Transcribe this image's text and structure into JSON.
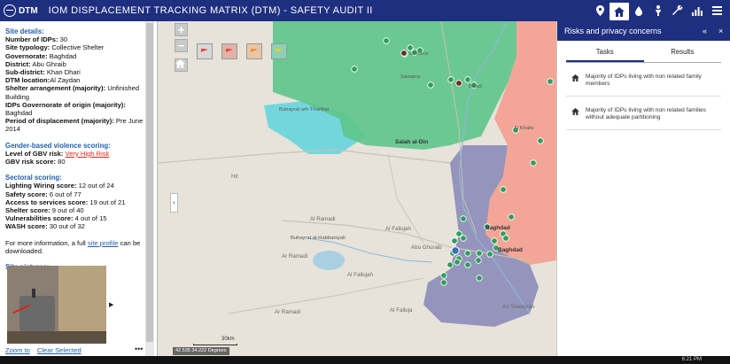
{
  "app": {
    "logo_text": "DTM",
    "title": "IOM  DISPLACEMENT TRACKING MATRIX (DTM) - SAFETY AUDIT II"
  },
  "header_icons": [
    "location-pin-icon",
    "home-icon",
    "water-drop-icon",
    "person-icon",
    "wrench-icon",
    "bar-chart-icon",
    "menu-icon"
  ],
  "site_details": {
    "heading": "Site details:",
    "rows": [
      {
        "label": "Number of IDPs:",
        "value": " 30"
      },
      {
        "label": "Site typology:",
        "value": " Collective Shelter"
      },
      {
        "label": "Governorate:",
        "value": " Baghdad"
      },
      {
        "label": "District:",
        "value": " Abu Ghraib"
      },
      {
        "label": "Sub-district:",
        "value": " Khan Dhari"
      },
      {
        "label": "DTM location:",
        "value": "Al Zaydan"
      },
      {
        "label": "Shelter arrangement (majority):",
        "value": " Unfinished Building"
      },
      {
        "label": "IDPs Governorate of origin (majority):",
        "value": " Baghdad"
      },
      {
        "label": "Period of displacement (majority):",
        "value": " Pre June 2014"
      }
    ]
  },
  "gbv": {
    "heading": "Gender-based violence scoring:",
    "risk_label": "Level of GBV risk:",
    "risk_value": "Very High Risk",
    "score_label": "GBV risk score:",
    "score_value": " 80"
  },
  "sectoral": {
    "heading": "Sectoral scoring:",
    "rows": [
      {
        "label": "Lighting Wiring score:",
        "value": " 12 out of 24"
      },
      {
        "label": "Safety score:",
        "value": " 6 out of 77"
      },
      {
        "label": "Access to services score:",
        "value": " 19 out of 21"
      },
      {
        "label": "Shelter score:",
        "value": " 9 out of 40"
      },
      {
        "label": "Vulnerabilities score:",
        "value": " 4 out of 15"
      },
      {
        "label": "WASH score:",
        "value": " 30 out of 32"
      }
    ]
  },
  "more_info": {
    "prefix": "For more information, a full ",
    "link": "site profile",
    "suffix": " can be downloaded."
  },
  "pictures": {
    "heading": "Site pictures:",
    "next_label": "▶"
  },
  "footer": {
    "zoom_to": "Zoom to",
    "clear_selected": "Clear Selected",
    "more": "•••"
  },
  "map": {
    "zoom_in": "+",
    "zoom_out": "−",
    "flag_colors": [
      "#e8453c",
      "#e8453c",
      "#f08a2a",
      "#f2d21e"
    ],
    "labels": [
      {
        "text": "Samarra",
        "cls": "city"
      },
      {
        "text": "Samarra",
        "cls": "city"
      },
      {
        "text": "Balad",
        "cls": "city"
      },
      {
        "text": "Buhayrat ath-Tharthar",
        "cls": "city"
      },
      {
        "text": "Salah al-Din",
        "cls": "dark"
      },
      {
        "text": "Al Khalis",
        "cls": "city"
      },
      {
        "text": "Hit",
        "cls": ""
      },
      {
        "text": "Al Ramadi",
        "cls": ""
      },
      {
        "text": "Al Fallujah",
        "cls": ""
      },
      {
        "text": "Baghdad",
        "cls": "dark"
      },
      {
        "text": "Baghdad",
        "cls": "dark"
      },
      {
        "text": "Abu Ghuraib",
        "cls": ""
      },
      {
        "text": "Buhayrat al-Habbaniyah",
        "cls": "city"
      },
      {
        "text": "Ar Ramadi",
        "cls": ""
      },
      {
        "text": "Al Fallujah",
        "cls": ""
      },
      {
        "text": "As Suwayrah",
        "cls": ""
      },
      {
        "text": "Al Falluja",
        "cls": ""
      },
      {
        "text": "Ar Ramadi",
        "cls": ""
      }
    ],
    "coordinates": "42.535 34.222 Degrees",
    "scale": "30km"
  },
  "panel": {
    "title": "Risks and privacy concerns",
    "collapse": "«",
    "close": "×",
    "tabs": [
      "Tasks",
      "Results"
    ],
    "items": [
      "Majority of IDPs living with non related family members",
      "Majority of IDPs living with non related families without adequate partitioning"
    ]
  },
  "taskbar": {
    "time": "6:21 PM"
  },
  "colors": {
    "header": "#1f2f80",
    "green_region": "#5ec48a",
    "salmon_region": "#f3a294",
    "purple_region": "#8f8fba",
    "teal_region": "#5fd3dd",
    "site_dot": "#2e9e5a",
    "link_blue": "#1f5fb0",
    "risk_red": "#e0281c"
  }
}
